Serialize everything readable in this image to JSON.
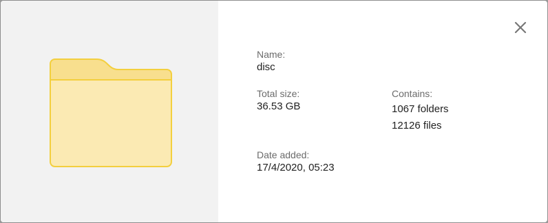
{
  "dialog": {
    "close_icon": "close-icon",
    "folder_icon": "folder-icon",
    "accent_color": "#f3cf3e",
    "folder_fill": "#fbeab3",
    "folder_tab_fill": "#f8df8e"
  },
  "name": {
    "label": "Name:",
    "value": "disc"
  },
  "total_size": {
    "label": "Total size:",
    "value": "36.53 GB"
  },
  "contains": {
    "label": "Contains:",
    "folders": "1067 folders",
    "files": "12126 files"
  },
  "date_added": {
    "label": "Date added:",
    "value": "17/4/2020, 05:23"
  }
}
